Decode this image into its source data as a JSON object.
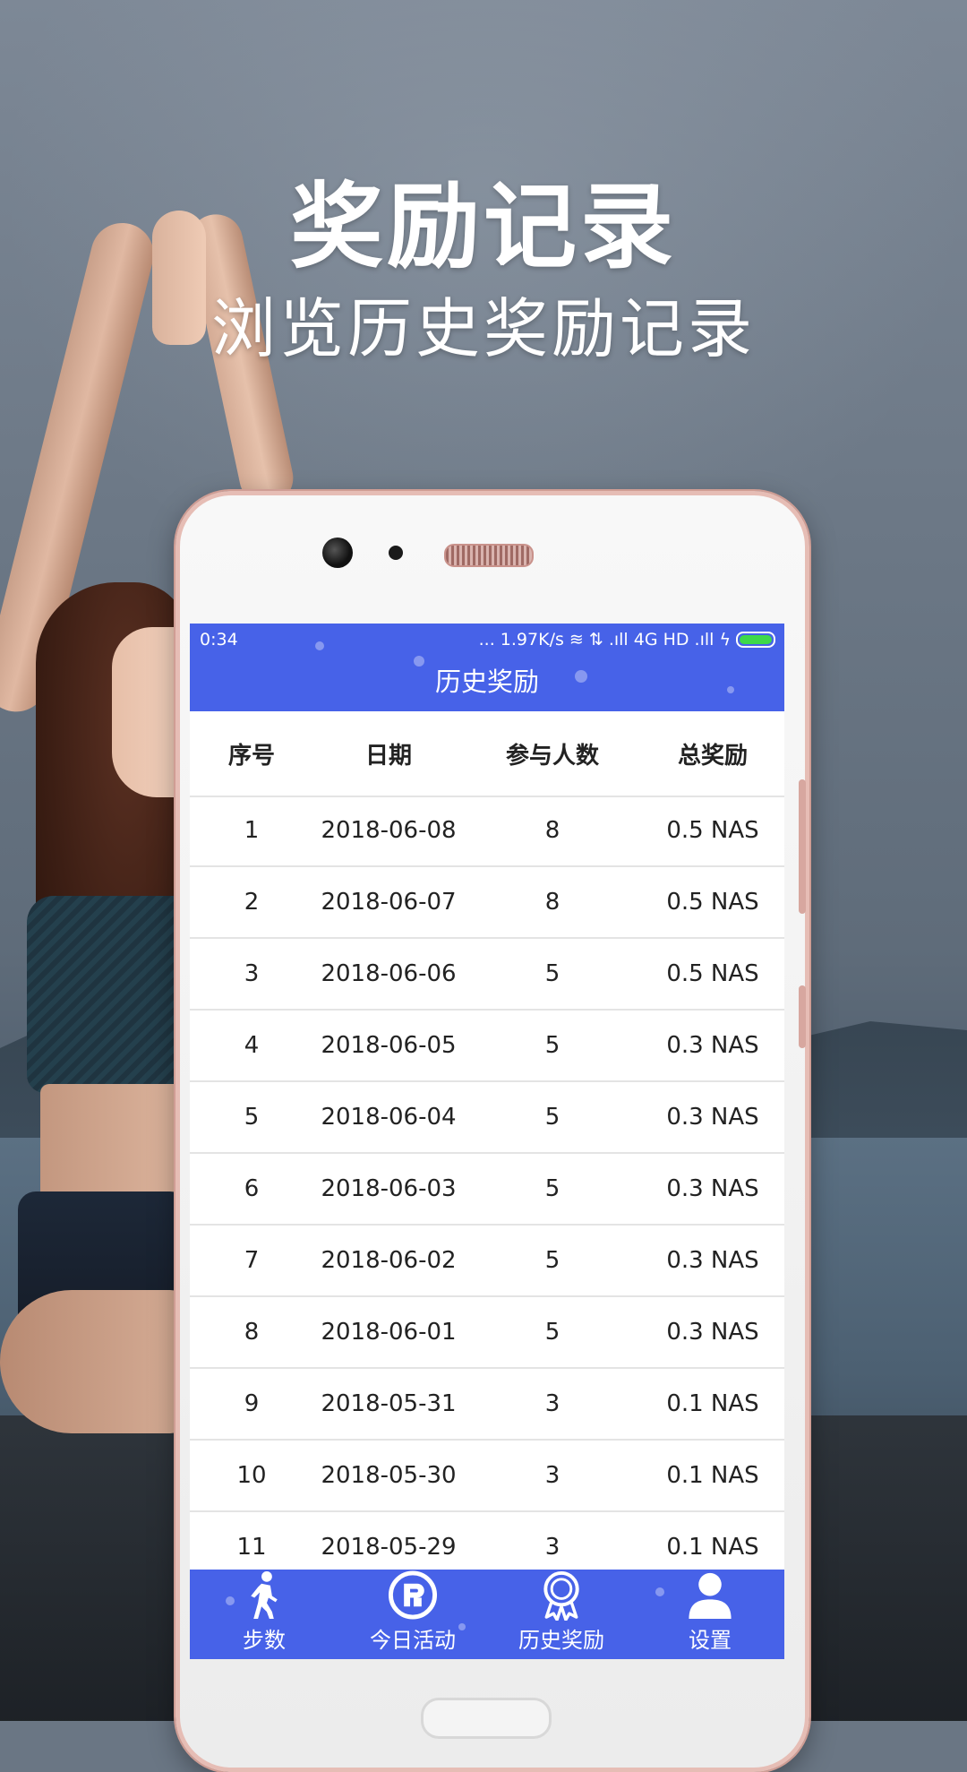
{
  "headline": {
    "title": "奖励记录",
    "subtitle": "浏览历史奖励记录"
  },
  "status_bar": {
    "time": "0:34",
    "right": "... 1.97K/s ≋ ⇅ .ıll 4G HD .ıll ϟ"
  },
  "app": {
    "title": "历史奖励"
  },
  "table": {
    "headers": [
      "序号",
      "日期",
      "参与人数",
      "总奖励"
    ],
    "rows": [
      [
        "1",
        "2018-06-08",
        "8",
        "0.5 NAS"
      ],
      [
        "2",
        "2018-06-07",
        "8",
        "0.5 NAS"
      ],
      [
        "3",
        "2018-06-06",
        "5",
        "0.5 NAS"
      ],
      [
        "4",
        "2018-06-05",
        "5",
        "0.3 NAS"
      ],
      [
        "5",
        "2018-06-04",
        "5",
        "0.3 NAS"
      ],
      [
        "6",
        "2018-06-03",
        "5",
        "0.3 NAS"
      ],
      [
        "7",
        "2018-06-02",
        "5",
        "0.3 NAS"
      ],
      [
        "8",
        "2018-06-01",
        "5",
        "0.3 NAS"
      ],
      [
        "9",
        "2018-05-31",
        "3",
        "0.1 NAS"
      ],
      [
        "10",
        "2018-05-30",
        "3",
        "0.1 NAS"
      ],
      [
        "11",
        "2018-05-29",
        "3",
        "0.1 NAS"
      ]
    ]
  },
  "tabs": [
    {
      "label": "步数",
      "icon": "walking-person-icon"
    },
    {
      "label": "今日活动",
      "icon": "activity-badge-icon"
    },
    {
      "label": "历史奖励",
      "icon": "award-ribbon-icon"
    },
    {
      "label": "设置",
      "icon": "user-profile-icon"
    }
  ],
  "colors": {
    "accent": "#4762e8",
    "battery": "#3ed84a",
    "phone_frame": "#e6bdb5"
  }
}
